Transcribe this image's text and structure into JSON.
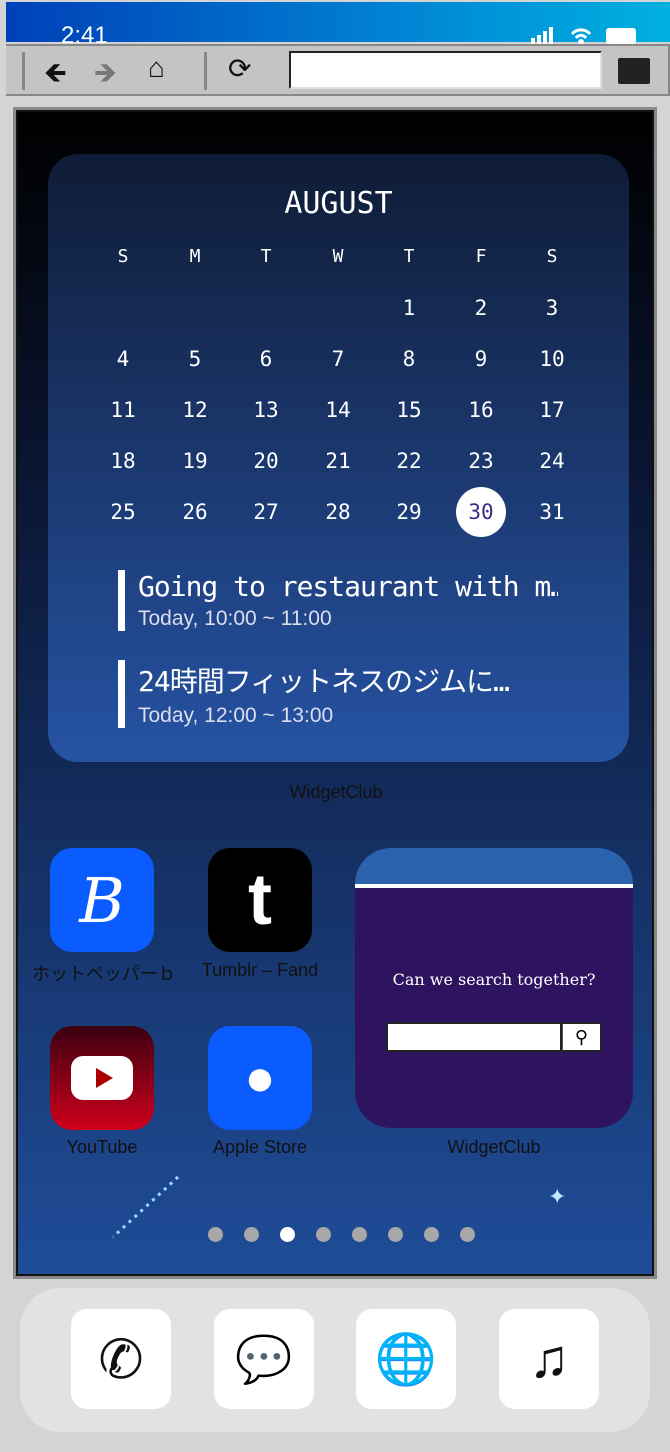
{
  "status": {
    "time": "2:41"
  },
  "toolbar": {
    "url": ""
  },
  "calendar": {
    "month": "AUGUST",
    "weekdays": [
      "S",
      "M",
      "T",
      "W",
      "T",
      "F",
      "S"
    ],
    "weeks": [
      [
        "",
        "",
        "",
        "",
        "1",
        "2",
        "3"
      ],
      [
        "4",
        "5",
        "6",
        "7",
        "8",
        "9",
        "10"
      ],
      [
        "11",
        "12",
        "13",
        "14",
        "15",
        "16",
        "17"
      ],
      [
        "18",
        "19",
        "20",
        "21",
        "22",
        "23",
        "24"
      ],
      [
        "25",
        "26",
        "27",
        "28",
        "29",
        "30",
        "31"
      ]
    ],
    "today": "30",
    "events": [
      {
        "title": "Going to restaurant with m…",
        "time": "Today, 10:00 ~ 11:00"
      },
      {
        "title": "24時間フィットネスのジムに…",
        "time": "Today, 12:00 ~ 13:00"
      }
    ],
    "label": "WidgetClub"
  },
  "apps": [
    {
      "name": "ホットペッパーｂ",
      "color": "#0a5cff"
    },
    {
      "name": "Tumblr – Fand",
      "color": "#000000"
    },
    {
      "name": "YouTube",
      "color": "#c0001a"
    },
    {
      "name": "Apple Store",
      "color": "#0a5cff"
    }
  ],
  "search_widget": {
    "prompt": "Can we search together?",
    "value": "",
    "label": "WidgetClub"
  },
  "pages": {
    "count": 8,
    "current": 3
  },
  "dock": [
    "phone",
    "messages",
    "browser",
    "music"
  ]
}
